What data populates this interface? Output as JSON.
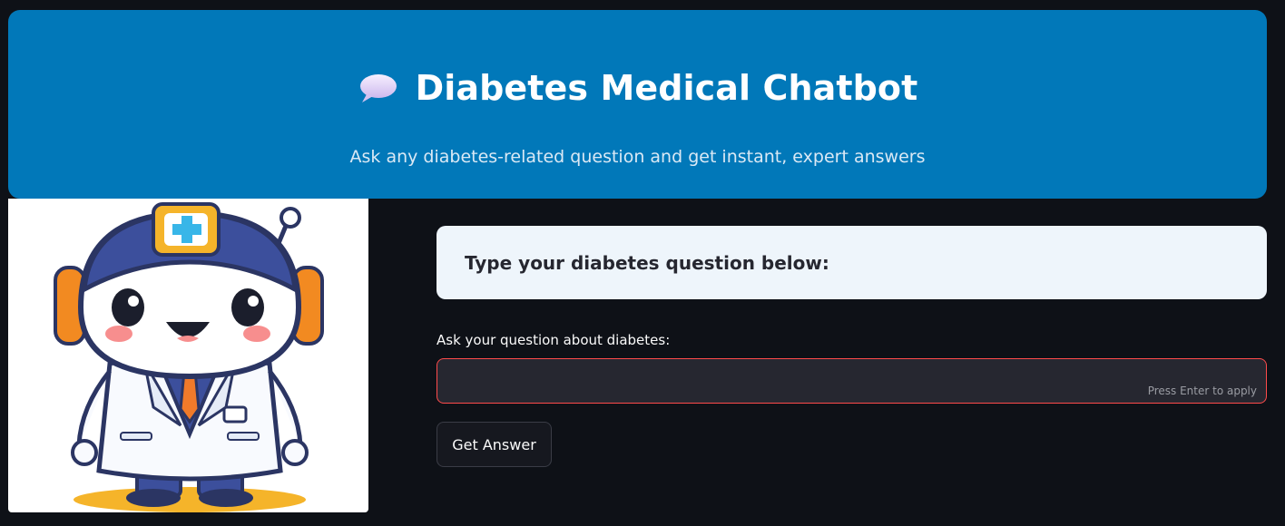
{
  "header": {
    "icon": "speech-bubble-icon",
    "title": "Diabetes Medical Chatbot",
    "subtitle": "Ask any diabetes-related question and get instant, expert answers",
    "background_color": "#0178b9"
  },
  "mascot": {
    "icon": "doctor-robot-mascot-image"
  },
  "prompt_card": {
    "text": "Type your diabetes question below:",
    "background_color": "#eef5fb"
  },
  "question_field": {
    "label": "Ask your question about diabetes:",
    "value": "",
    "hint": "Press Enter to apply",
    "border_color": "#ff4b4b"
  },
  "actions": {
    "submit_label": "Get Answer"
  },
  "theme": {
    "page_background": "#0e1117"
  }
}
